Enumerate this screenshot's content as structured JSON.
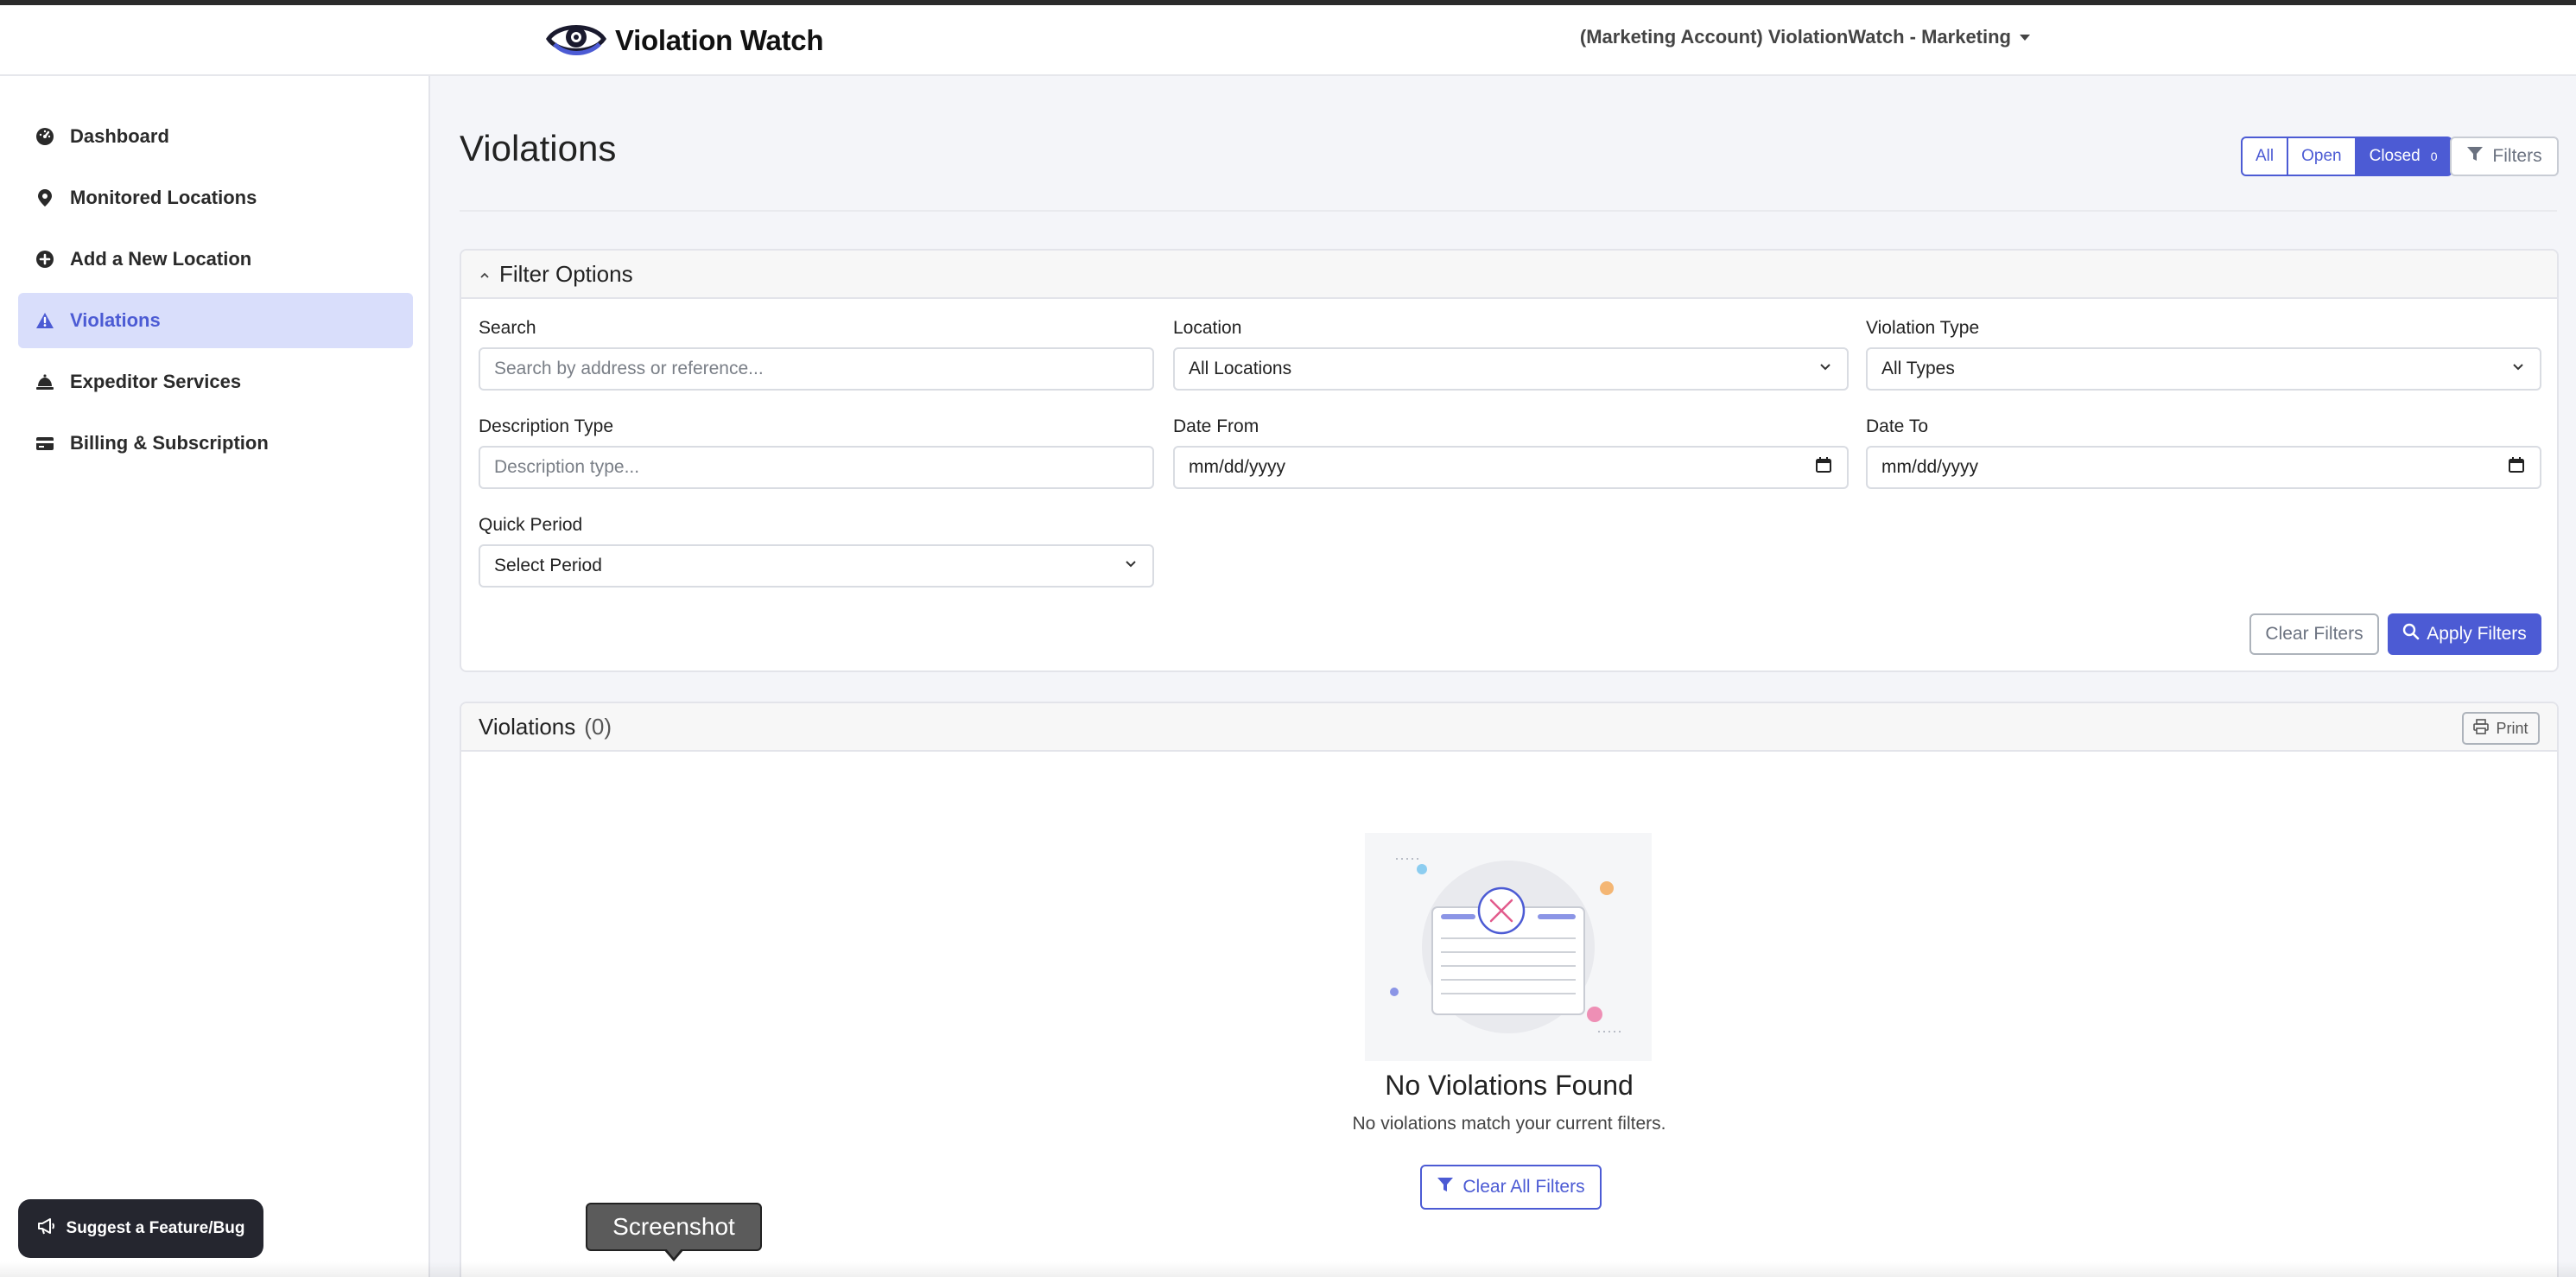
{
  "brand": {
    "name": "Violation Watch",
    "logo_icon": "eye-logo-icon"
  },
  "account": {
    "label": "(Marketing Account) ViolationWatch - Marketing"
  },
  "sidebar": {
    "items": [
      {
        "label": "Dashboard",
        "icon": "speedometer-icon",
        "active": false
      },
      {
        "label": "Monitored Locations",
        "icon": "map-pin-icon",
        "active": false
      },
      {
        "label": "Add a New Location",
        "icon": "plus-circle-icon",
        "active": false
      },
      {
        "label": "Violations",
        "icon": "warning-triangle-icon",
        "active": true
      },
      {
        "label": "Expeditor Services",
        "icon": "service-bell-icon",
        "active": false
      },
      {
        "label": "Billing & Subscription",
        "icon": "credit-card-icon",
        "active": false
      }
    ],
    "suggest_label": "Suggest a Feature/Bug"
  },
  "page": {
    "title": "Violations",
    "status_filter": {
      "all": "All",
      "open": "Open",
      "closed": "Closed",
      "closed_count": "0",
      "selected": "Closed"
    },
    "filters_label": "Filters"
  },
  "filter_options": {
    "title": "Filter Options",
    "search": {
      "label": "Search",
      "placeholder": "Search by address or reference..."
    },
    "location": {
      "label": "Location",
      "value": "All Locations"
    },
    "violation_type": {
      "label": "Violation Type",
      "value": "All Types"
    },
    "description_type": {
      "label": "Description Type",
      "placeholder": "Description type..."
    },
    "date_from": {
      "label": "Date From",
      "value": "mm/dd/yyyy"
    },
    "date_to": {
      "label": "Date To",
      "value": "mm/dd/yyyy"
    },
    "quick_period": {
      "label": "Quick Period",
      "value": "Select Period"
    },
    "clear_label": "Clear Filters",
    "apply_label": "Apply Filters"
  },
  "violations_list": {
    "title": "Violations",
    "count": "(0)",
    "print_label": "Print",
    "empty_title": "No Violations Found",
    "empty_subtitle": "No violations match your current filters.",
    "clear_all_label": "Clear All Filters"
  },
  "tooltip": {
    "text": "Screenshot"
  },
  "colors": {
    "accent": "#4c5bd4",
    "active_bg": "#d9defb",
    "dark_button": "#25262f"
  }
}
